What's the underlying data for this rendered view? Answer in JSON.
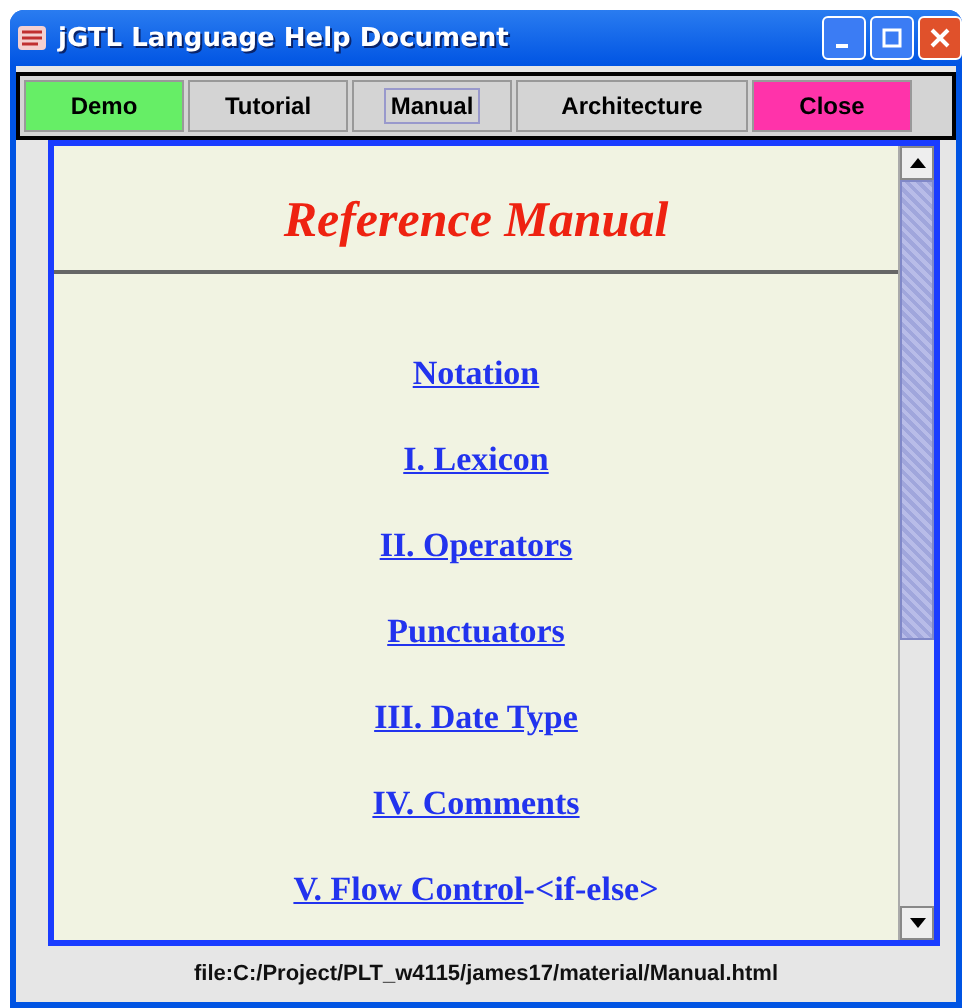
{
  "window": {
    "title": "jGTL Language Help Document"
  },
  "toolbar": [
    {
      "label": "Demo",
      "color": "#66ee66",
      "focused": false
    },
    {
      "label": "Tutorial",
      "color": "#d4d4d4",
      "focused": false
    },
    {
      "label": "Manual",
      "color": "#d4d4d4",
      "focused": true
    },
    {
      "label": "Architecture",
      "color": "#d4d4d4",
      "focused": false
    },
    {
      "label": "Close",
      "color": "#ff33aa",
      "focused": false
    }
  ],
  "document": {
    "heading": "Reference Manual",
    "links": [
      {
        "text": "Notation"
      },
      {
        "text": "I. Lexicon"
      },
      {
        "text": "II. Operators"
      },
      {
        "text": "Punctuators"
      },
      {
        "text": "III. Date Type"
      },
      {
        "text": "IV. Comments"
      },
      {
        "text": "V. Flow Control",
        "suffix": "-<if-else>"
      }
    ]
  },
  "status_bar": "file:C:/Project/PLT_w4115/james17/material/Manual.html"
}
